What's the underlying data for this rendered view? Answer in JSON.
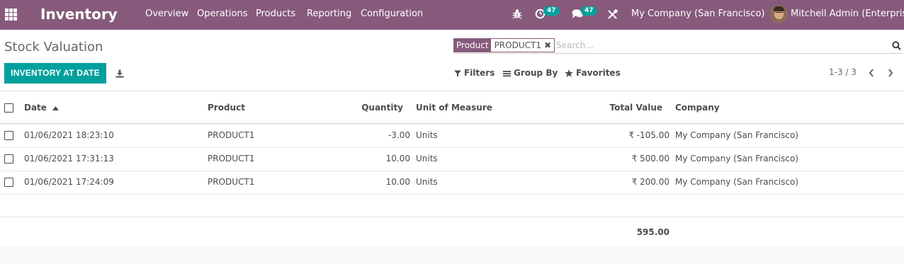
{
  "navbar": {
    "app_name": "Inventory",
    "menu": [
      "Overview",
      "Operations",
      "Products",
      "Reporting",
      "Configuration"
    ],
    "activity_count": "47",
    "messages_count": "47",
    "company": "My Company (San Francisco)",
    "user": "Mitchell Admin (Enterprise)",
    "icons": [
      "apps-grid-icon",
      "bug-icon",
      "activity-clock-icon",
      "chat-icon",
      "tools-icon"
    ]
  },
  "control_panel": {
    "title": "Stock Valuation",
    "primary_button": "INVENTORY AT DATE",
    "search": {
      "facet_label": "Product",
      "facet_value": "PRODUCT1",
      "placeholder": "Search..."
    },
    "filters_label": "Filters",
    "group_by_label": "Group By",
    "favorites_label": "Favorites",
    "pager": "1-3 / 3"
  },
  "table": {
    "columns": {
      "date": "Date",
      "product": "Product",
      "quantity": "Quantity",
      "uom": "Unit of Measure",
      "total_value": "Total Value",
      "company": "Company"
    },
    "rows": [
      {
        "date": "01/06/2021 18:23:10",
        "product": "PRODUCT1",
        "quantity": "-3.00",
        "uom": "Units",
        "total_value": "₹ -105.00",
        "company": "My Company (San Francisco)"
      },
      {
        "date": "01/06/2021 17:31:13",
        "product": "PRODUCT1",
        "quantity": "10.00",
        "uom": "Units",
        "total_value": "₹ 500.00",
        "company": "My Company (San Francisco)"
      },
      {
        "date": "01/06/2021 17:24:09",
        "product": "PRODUCT1",
        "quantity": "10.00",
        "uom": "Units",
        "total_value": "₹ 200.00",
        "company": "My Company (San Francisco)"
      }
    ],
    "total_value_sum": "595.00"
  },
  "colors": {
    "navbar": "#875a7b",
    "primary_button": "#00a09d",
    "badge": "#00a09d"
  }
}
